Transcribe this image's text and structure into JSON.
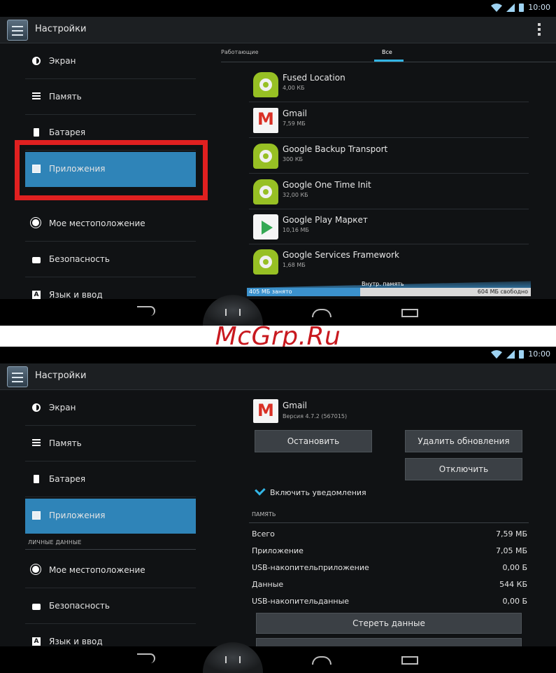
{
  "status_bar": {
    "time": "10:00"
  },
  "action_bar": {
    "title": "Настройки"
  },
  "sidebar": {
    "items": [
      {
        "label": "Экран",
        "icon": "brightness-icon"
      },
      {
        "label": "Память",
        "icon": "storage-icon"
      },
      {
        "label": "Батарея",
        "icon": "battery-icon"
      },
      {
        "label": "Приложения",
        "icon": "apps-icon"
      },
      {
        "label": "Мое местоположение",
        "icon": "location-icon"
      },
      {
        "label": "Безопасность",
        "icon": "lock-icon"
      },
      {
        "label": "Язык и ввод",
        "icon": "language-icon"
      }
    ],
    "section_personal": "ЛИЧНЫЕ ДАННЫЕ"
  },
  "apps_list": {
    "tabs": [
      "Работающие",
      "Все"
    ],
    "selected_tab": "Все",
    "apps": [
      {
        "name": "Fused Location",
        "size": "4,00 КБ",
        "icon": "android-icon"
      },
      {
        "name": "Gmail",
        "size": "7,59 МБ",
        "icon": "gmail-icon"
      },
      {
        "name": "Google Backup Transport",
        "size": "300 КБ",
        "icon": "android-icon"
      },
      {
        "name": "Google One Time Init",
        "size": "32,00 КБ",
        "icon": "android-icon"
      },
      {
        "name": "Google Play Маркет",
        "size": "10,16 МБ",
        "icon": "play-store-icon"
      },
      {
        "name": "Google Services Framework",
        "size": "1,68 МБ",
        "icon": "android-icon"
      }
    ],
    "storage": {
      "label": "Внутр. память",
      "used": "405 МБ занято",
      "free": "604 МБ свободно",
      "used_fraction": 0.4
    }
  },
  "app_detail": {
    "name": "Gmail",
    "version": "Версия 4.7.2 (567015)",
    "buttons": {
      "stop": "Остановить",
      "uninstall_updates": "Удалить обновления",
      "disable": "Отключить",
      "clear_data": "Стереть данные"
    },
    "notifications_label": "Включить уведомления",
    "notifications_checked": true,
    "memory_header": "ПАМЯТЬ",
    "memory_rows": [
      {
        "key": "Всего",
        "value": "7,59 МБ"
      },
      {
        "key": "Приложение",
        "value": "7,05 МБ"
      },
      {
        "key": "USB-накопительприложение",
        "value": "0,00 Б"
      },
      {
        "key": "Данные",
        "value": "544 КБ"
      },
      {
        "key": "USB-накопительданные",
        "value": "0,00 Б"
      }
    ]
  },
  "watermark": "McGrp.Ru",
  "colors": {
    "accent": "#33b5e5",
    "selected": "#2f84b8",
    "highlight": "#e02020",
    "watermark": "#c8191f"
  }
}
